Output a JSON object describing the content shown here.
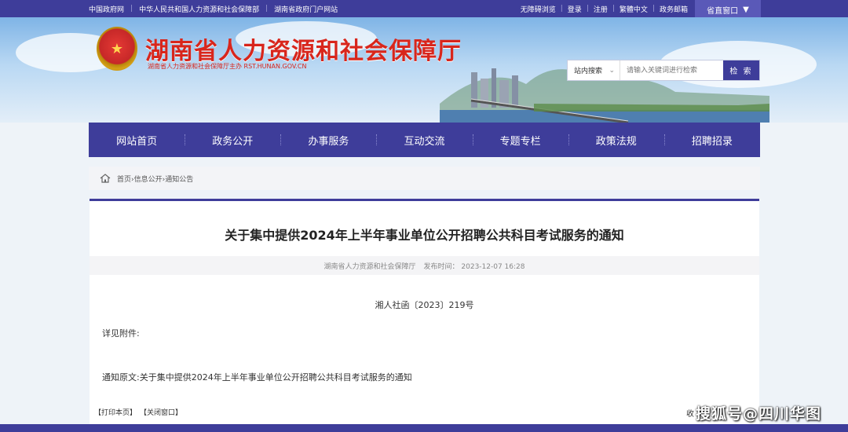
{
  "topbar": {
    "left_links": [
      "中国政府网",
      "中华人民共和国人力资源和社会保障部",
      "湖南省政府门户网站"
    ],
    "right_links": [
      "无障碍浏览",
      "登录",
      "注册",
      "繁體中文",
      "政务邮箱"
    ],
    "province_window": "省直窗口"
  },
  "header": {
    "title": "湖南省人力资源和社会保障厅",
    "subtitle": "湖南省人力资源和社会保障厅主办  RST.HUNAN.GOV.CN"
  },
  "search": {
    "scope": "站内搜索",
    "placeholder": "请输入关键词进行检索",
    "button": "检 索"
  },
  "nav": [
    "网站首页",
    "政务公开",
    "办事服务",
    "互动交流",
    "专题专栏",
    "政策法规",
    "招聘招录"
  ],
  "breadcrumb": "首页›信息公开›通知公告",
  "article": {
    "title": "关于集中提供2024年上半年事业单位公开招聘公共科目考试服务的通知",
    "source": "湖南省人力资源和社会保障厅",
    "publish_label": "发布时间：",
    "publish_time": "2023-12-07 16:28",
    "doc_number": "湘人社函〔2023〕219号",
    "detail": "详见附件:",
    "original": "通知原文:关于集中提供2024年上半年事业单位公开招聘公共科目考试服务的通知"
  },
  "footer": {
    "print": "【打印本页】",
    "close": "【关闭窗口】",
    "collect": "收"
  },
  "watermark": "搜狐号@四川华图",
  "colors": {
    "brand": "#3e3d9a",
    "title_red": "#d8261c"
  }
}
